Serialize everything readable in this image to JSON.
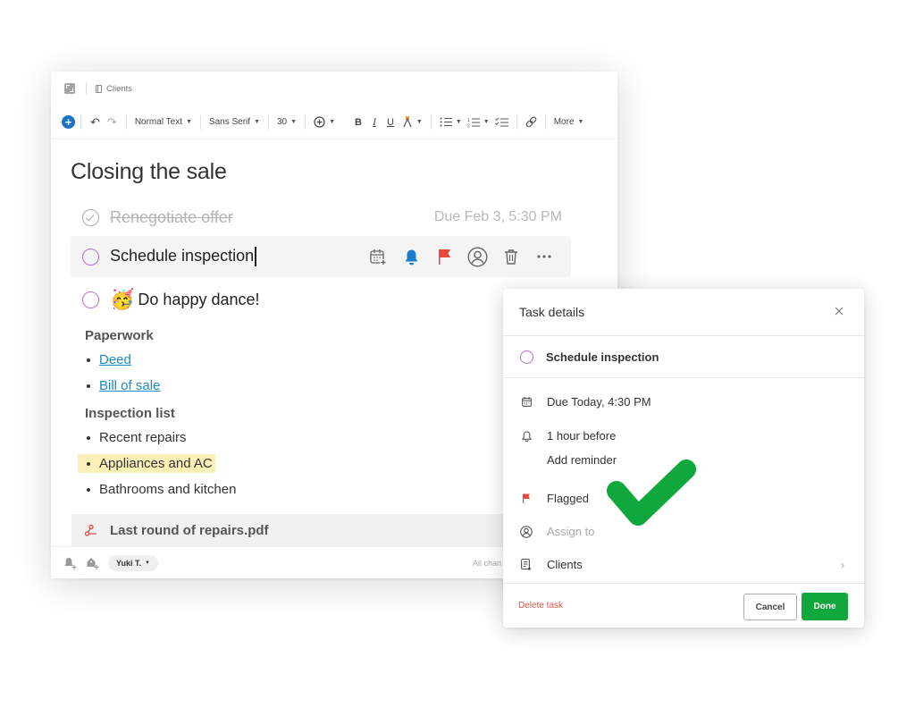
{
  "editor": {
    "notebook": "Clients",
    "toolbar": {
      "text_style": "Normal Text",
      "font": "Sans Serif",
      "size": "30",
      "bold": "B",
      "italic": "I",
      "underline": "U",
      "more": "More"
    },
    "title": "Closing the sale",
    "tasks": [
      {
        "text": "Renegotiate offer",
        "completed": true,
        "due": "Due Feb 3, 5:30 PM"
      },
      {
        "text": "Schedule inspection",
        "completed": false,
        "active": true
      },
      {
        "emoji": "🥳",
        "text": "Do happy dance!",
        "completed": false
      }
    ],
    "sections": [
      {
        "heading": "Paperwork",
        "items": [
          {
            "text": "Deed",
            "link": true
          },
          {
            "text": "Bill of sale",
            "link": true
          }
        ]
      },
      {
        "heading": "Inspection list",
        "items": [
          {
            "text": "Recent repairs"
          },
          {
            "text": "Appliances and AC",
            "highlighted": true
          },
          {
            "text": "Bathrooms and kitchen"
          }
        ]
      }
    ],
    "attachment": "Last round of repairs.pdf",
    "footer": {
      "user": "Yuki T.",
      "status": "All chan"
    }
  },
  "task_details": {
    "title": "Task details",
    "task_name": "Schedule inspection",
    "due": "Due Today, 4:30 PM",
    "reminder": "1 hour before",
    "add_reminder": "Add reminder",
    "flag": "Flagged",
    "assign_placeholder": "Assign to",
    "notebook": "Clients",
    "delete_label": "Delete task",
    "cancel_label": "Cancel",
    "done_label": "Done"
  },
  "colors": {
    "accent_blue": "#1a73c8",
    "link": "#1a8ac8",
    "flag_red": "#e8453c",
    "done_green": "#10a83c",
    "task_circle": "#b36fd1",
    "highlight": "#fdf0b6"
  }
}
